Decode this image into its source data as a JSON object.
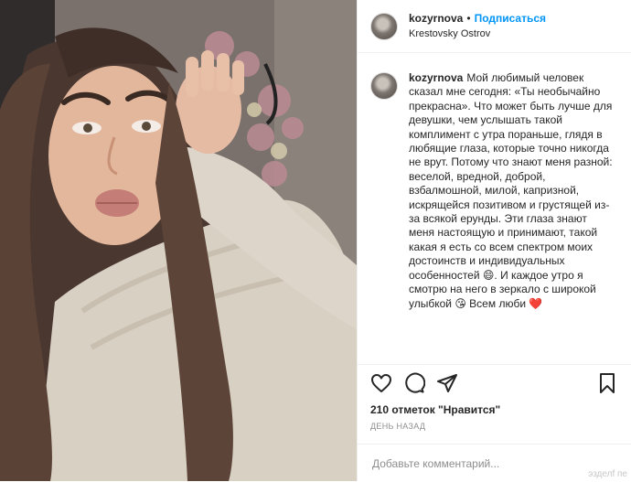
{
  "header": {
    "username": "kozyrnova",
    "dot": "•",
    "follow_label": "Подписаться",
    "location": "Krestovsky Ostrov"
  },
  "caption": {
    "username": "kozyrnova",
    "text": "Мой любимый человек сказал мне сегодня: «Ты необычайно прекрасна». Что может быть лучше для девушки, чем услышать такой комплимент с утра пораньше, глядя в любящие глаза, которые точно никогда не врут. Потому что знают меня разной: веселой, вредной, доброй, взбалмошной, милой, капризной, искрящейся позитивом и грустящей из-за всякой ерунды. Эти глаза знают меня настоящую и принимают, такой какая я есть со всем спектром моих достоинств и индивидуальных особенностей 😄. И каждое утро я смотрю на него в зеркало с широкой улыбкой 😘 Всем люби ❤️"
  },
  "actions": {
    "icons": [
      "heart-icon",
      "comment-icon",
      "share-icon",
      "bookmark-icon"
    ]
  },
  "likes": "210 отметок \"Нравится\"",
  "timestamp": "ДЕНЬ НАЗАД",
  "comment": {
    "placeholder": "Добавьте комментарий..."
  },
  "watermark": "эзделf пе",
  "colors": {
    "accent": "#0095f6",
    "text": "#262626",
    "muted": "#8e8e8e",
    "border": "#efefef"
  }
}
